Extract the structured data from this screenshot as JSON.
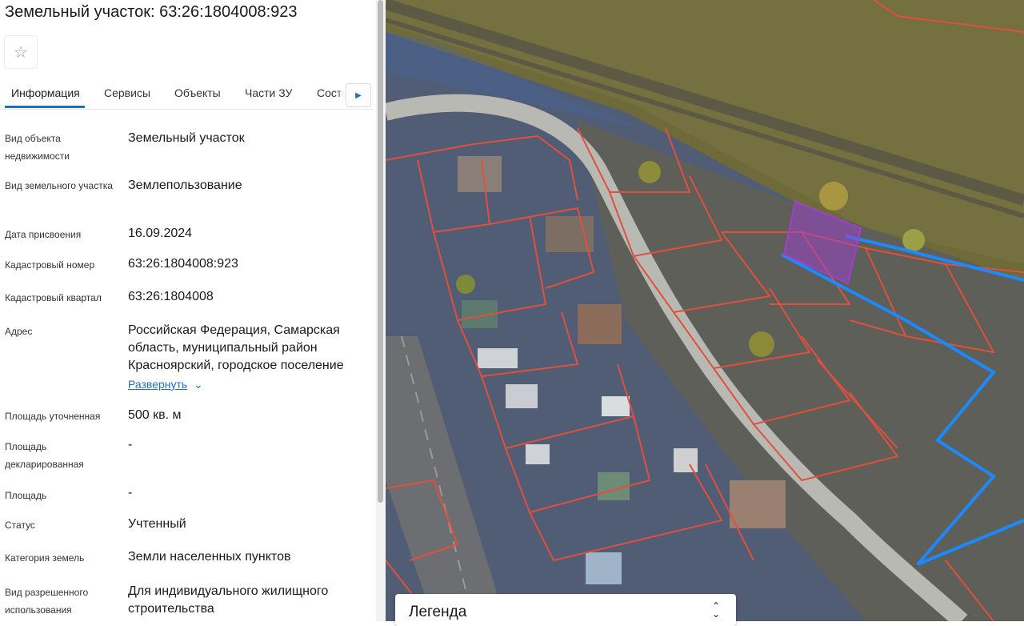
{
  "panel": {
    "title": "Земельный участок: 63:26:1804008:923",
    "favorite_icon": "star-outline-icon",
    "tabs": [
      {
        "label": "Информация",
        "active": true
      },
      {
        "label": "Сервисы"
      },
      {
        "label": "Объекты"
      },
      {
        "label": "Части ЗУ"
      },
      {
        "label": "Соста"
      }
    ],
    "tab_scroll_icon": "triangle-right-icon",
    "fields": [
      {
        "label": "Вид объекта недвижимости",
        "value": "Земельный участок"
      },
      {
        "label": "Вид земельного участка",
        "value": "Землепользование"
      },
      {
        "label": "Дата присвоения",
        "value": "16.09.2024"
      },
      {
        "label": "Кадастровый номер",
        "value": "63:26:1804008:923"
      },
      {
        "label": "Кадастровый квартал",
        "value": "63:26:1804008"
      },
      {
        "label": "Адрес",
        "value": "Российская Федерация, Самарская область, муниципальный район Красноярский, городское поселение"
      },
      {
        "label": "Площадь уточненная",
        "value": "500 кв. м"
      },
      {
        "label": "Площадь декларированная",
        "value": "-"
      },
      {
        "label": "Площадь",
        "value": "-"
      },
      {
        "label": "Статус",
        "value": "Учтенный"
      },
      {
        "label": "Категория земель",
        "value": "Земли населенных пунктов"
      },
      {
        "label": "Вид разрешенного использования",
        "value": "Для индивидуального жилищного строительства"
      }
    ],
    "expand_label": "Развернуть",
    "expand_icon": "chevron-down-icon"
  },
  "map": {
    "legend_label": "Легенда",
    "legend_icon": "chevron-up-down-icon",
    "colors": {
      "parcel_border": "#e0503c",
      "zone_border": "#1e88ff",
      "selected_parcel": "#a040d0",
      "railway_zone": "#8a7a3a"
    }
  }
}
